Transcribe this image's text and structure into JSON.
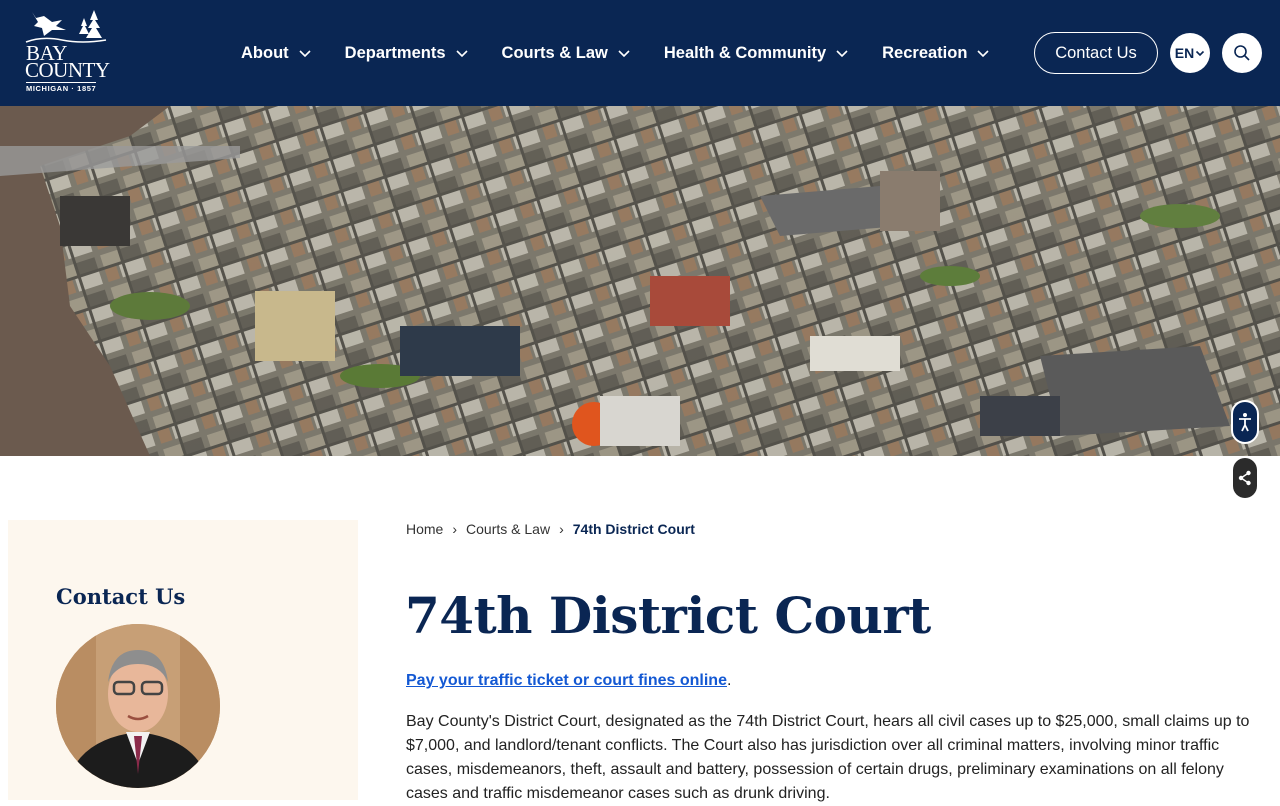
{
  "header": {
    "logo": {
      "line1": "BAY",
      "line2": "COUNTY",
      "line3": "MICHIGAN · 1857"
    },
    "nav": [
      {
        "label": "About"
      },
      {
        "label": "Departments"
      },
      {
        "label": "Courts & Law"
      },
      {
        "label": "Health & Community"
      },
      {
        "label": "Recreation"
      }
    ],
    "contact_label": "Contact Us",
    "language": "EN"
  },
  "hero": {
    "icon": "accessibility-icon",
    "share_icon": "share-icon"
  },
  "sidebar": {
    "title": "Contact Us"
  },
  "breadcrumb": {
    "home": "Home",
    "section": "Courts & Law",
    "current": "74th District Court"
  },
  "main": {
    "title": "74th District Court",
    "pay_link": "Pay your traffic ticket or court fines online",
    "pay_suffix": ".",
    "description": "Bay County's District Court, designated as the 74th District Court, hears all civil cases up to $25,000, small claims up to $7,000, and landlord/tenant conflicts. The Court also has jurisdiction over all criminal matters, involving minor traffic cases, misdemeanors, theft, assault and battery, possession of certain drugs, preliminary examinations on all felony cases and traffic misdemeanor cases such as drunk driving."
  },
  "colors": {
    "navy": "#0a2653",
    "link": "#1358d3",
    "sidebar_bg": "#fdf7ee"
  }
}
